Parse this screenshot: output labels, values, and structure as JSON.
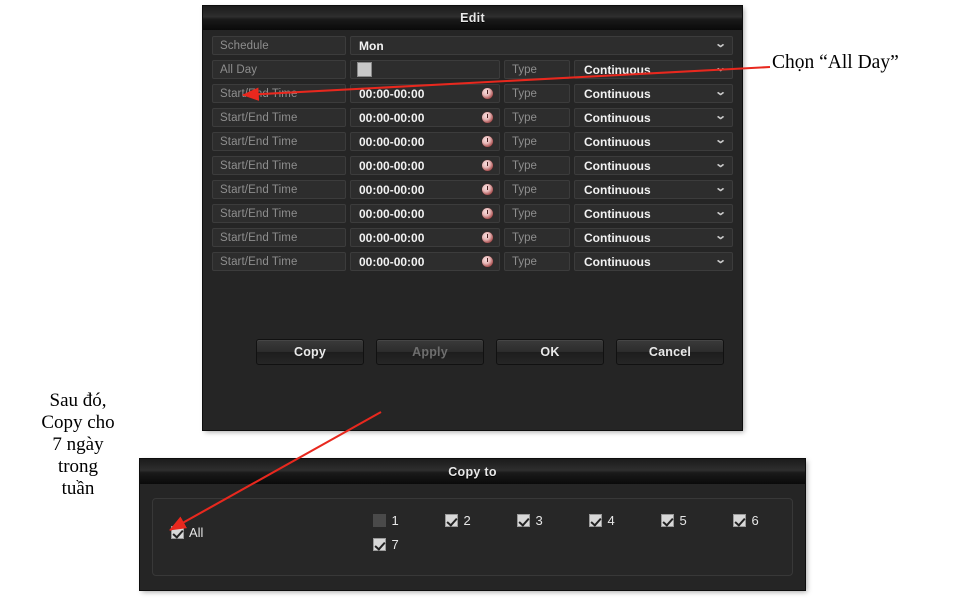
{
  "annotations": {
    "all_day": "Chọn “All Day”",
    "copy": "Sau đó,\nCopy cho\n7 ngày\ntrong\ntuần",
    "arrow_color": "#e8281e"
  },
  "edit_dialog": {
    "title": "Edit",
    "schedule": {
      "label": "Schedule",
      "value": "Mon",
      "caret": "chevron-down-icon"
    },
    "all_day": {
      "label": "All Day",
      "checked": false,
      "type_label": "Type",
      "type_value": "Continuous"
    },
    "time_rows": [
      {
        "label": "Start/End Time",
        "value": "00:00-00:00",
        "type_label": "Type",
        "type_value": "Continuous"
      },
      {
        "label": "Start/End Time",
        "value": "00:00-00:00",
        "type_label": "Type",
        "type_value": "Continuous"
      },
      {
        "label": "Start/End Time",
        "value": "00:00-00:00",
        "type_label": "Type",
        "type_value": "Continuous"
      },
      {
        "label": "Start/End Time",
        "value": "00:00-00:00",
        "type_label": "Type",
        "type_value": "Continuous"
      },
      {
        "label": "Start/End Time",
        "value": "00:00-00:00",
        "type_label": "Type",
        "type_value": "Continuous"
      },
      {
        "label": "Start/End Time",
        "value": "00:00-00:00",
        "type_label": "Type",
        "type_value": "Continuous"
      },
      {
        "label": "Start/End Time",
        "value": "00:00-00:00",
        "type_label": "Type",
        "type_value": "Continuous"
      },
      {
        "label": "Start/End Time",
        "value": "00:00-00:00",
        "type_label": "Type",
        "type_value": "Continuous"
      }
    ],
    "buttons": {
      "copy": "Copy",
      "apply": "Apply",
      "ok": "OK",
      "cancel": "Cancel"
    }
  },
  "copy_dialog": {
    "title": "Copy to",
    "all": {
      "label": "All",
      "checked": true
    },
    "days": [
      {
        "label": "1",
        "checked": false
      },
      {
        "label": "2",
        "checked": true
      },
      {
        "label": "3",
        "checked": true
      },
      {
        "label": "4",
        "checked": true
      },
      {
        "label": "5",
        "checked": true
      },
      {
        "label": "6",
        "checked": true
      },
      {
        "label": "7",
        "checked": true
      }
    ]
  }
}
